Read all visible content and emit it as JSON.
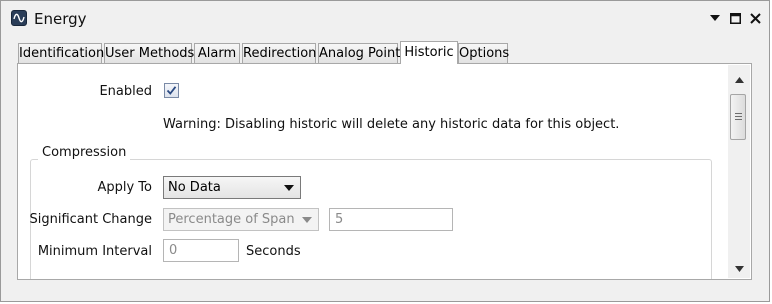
{
  "window": {
    "title": "Energy",
    "icon": "waveform-icon",
    "controls": [
      "dropdown-arrow-icon",
      "maximize-icon",
      "close-icon"
    ]
  },
  "tabs": [
    {
      "label": "Identification",
      "active": false
    },
    {
      "label": "User Methods",
      "active": false
    },
    {
      "label": "Alarm",
      "active": false
    },
    {
      "label": "Redirection",
      "active": false
    },
    {
      "label": "Analog Point",
      "active": false
    },
    {
      "label": "Historic",
      "active": true
    },
    {
      "label": "Options",
      "active": false
    }
  ],
  "historic": {
    "enabled_label": "Enabled",
    "enabled_checked": true,
    "warning": "Warning: Disabling historic will delete any historic data for this object.",
    "compression": {
      "legend": "Compression",
      "apply_to_label": "Apply To",
      "apply_to_value": "No Data",
      "significant_change_label": "Significant Change",
      "significant_change_mode": "Percentage of Span",
      "significant_change_value": "5",
      "minimum_interval_label": "Minimum Interval",
      "minimum_interval_value": "0",
      "seconds_label": "Seconds"
    }
  },
  "colors": {
    "window_bg": "#f0f0f0",
    "panel_bg": "#ffffff",
    "icon_bg": "#2a3d58"
  }
}
